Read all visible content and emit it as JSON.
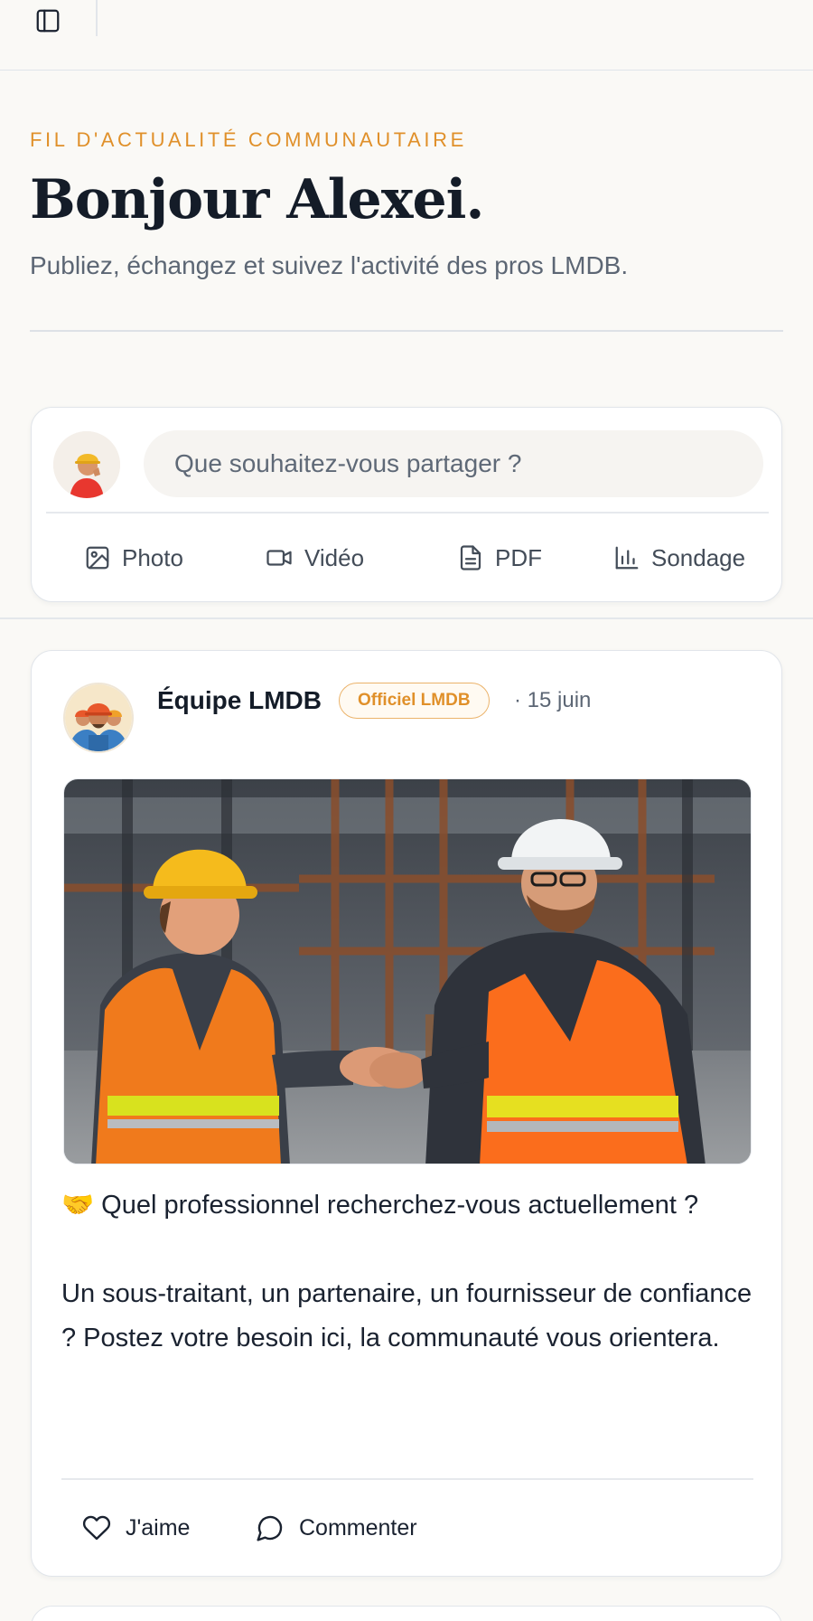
{
  "header": {
    "sidebar_toggle_icon": "sidebar-panel-icon"
  },
  "hero": {
    "eyebrow": "FIL D'ACTUALITÉ COMMUNAUTAIRE",
    "title": "Bonjour Alexei.",
    "subtitle": "Publiez, échangez et suivez l'activité des pros LMDB."
  },
  "composer": {
    "placeholder": "Que souhaitez-vous partager ?",
    "actions": [
      {
        "label": "Photo",
        "icon": "image-icon"
      },
      {
        "label": "Vidéo",
        "icon": "video-camera-icon"
      },
      {
        "label": "PDF",
        "icon": "document-icon"
      },
      {
        "label": "Sondage",
        "icon": "bar-chart-icon"
      }
    ]
  },
  "post": {
    "author": "Équipe LMDB",
    "badge": "Officiel LMDB",
    "date": "· 15 juin",
    "line1": "🤝 Quel professionnel recherchez-vous actuellement ?",
    "line2": "Un sous-traitant, un partenaire, un fournisseur de confiance ? Postez votre besoin ici, la communauté vous orientera.",
    "actions": [
      {
        "label": "J'aime",
        "icon": "heart-icon"
      },
      {
        "label": "Commenter",
        "icon": "comment-bubble-icon"
      }
    ]
  },
  "colors": {
    "accent": "#e0902a",
    "text": "#141c28",
    "muted": "#5c6674",
    "background": "#faf9f6"
  }
}
